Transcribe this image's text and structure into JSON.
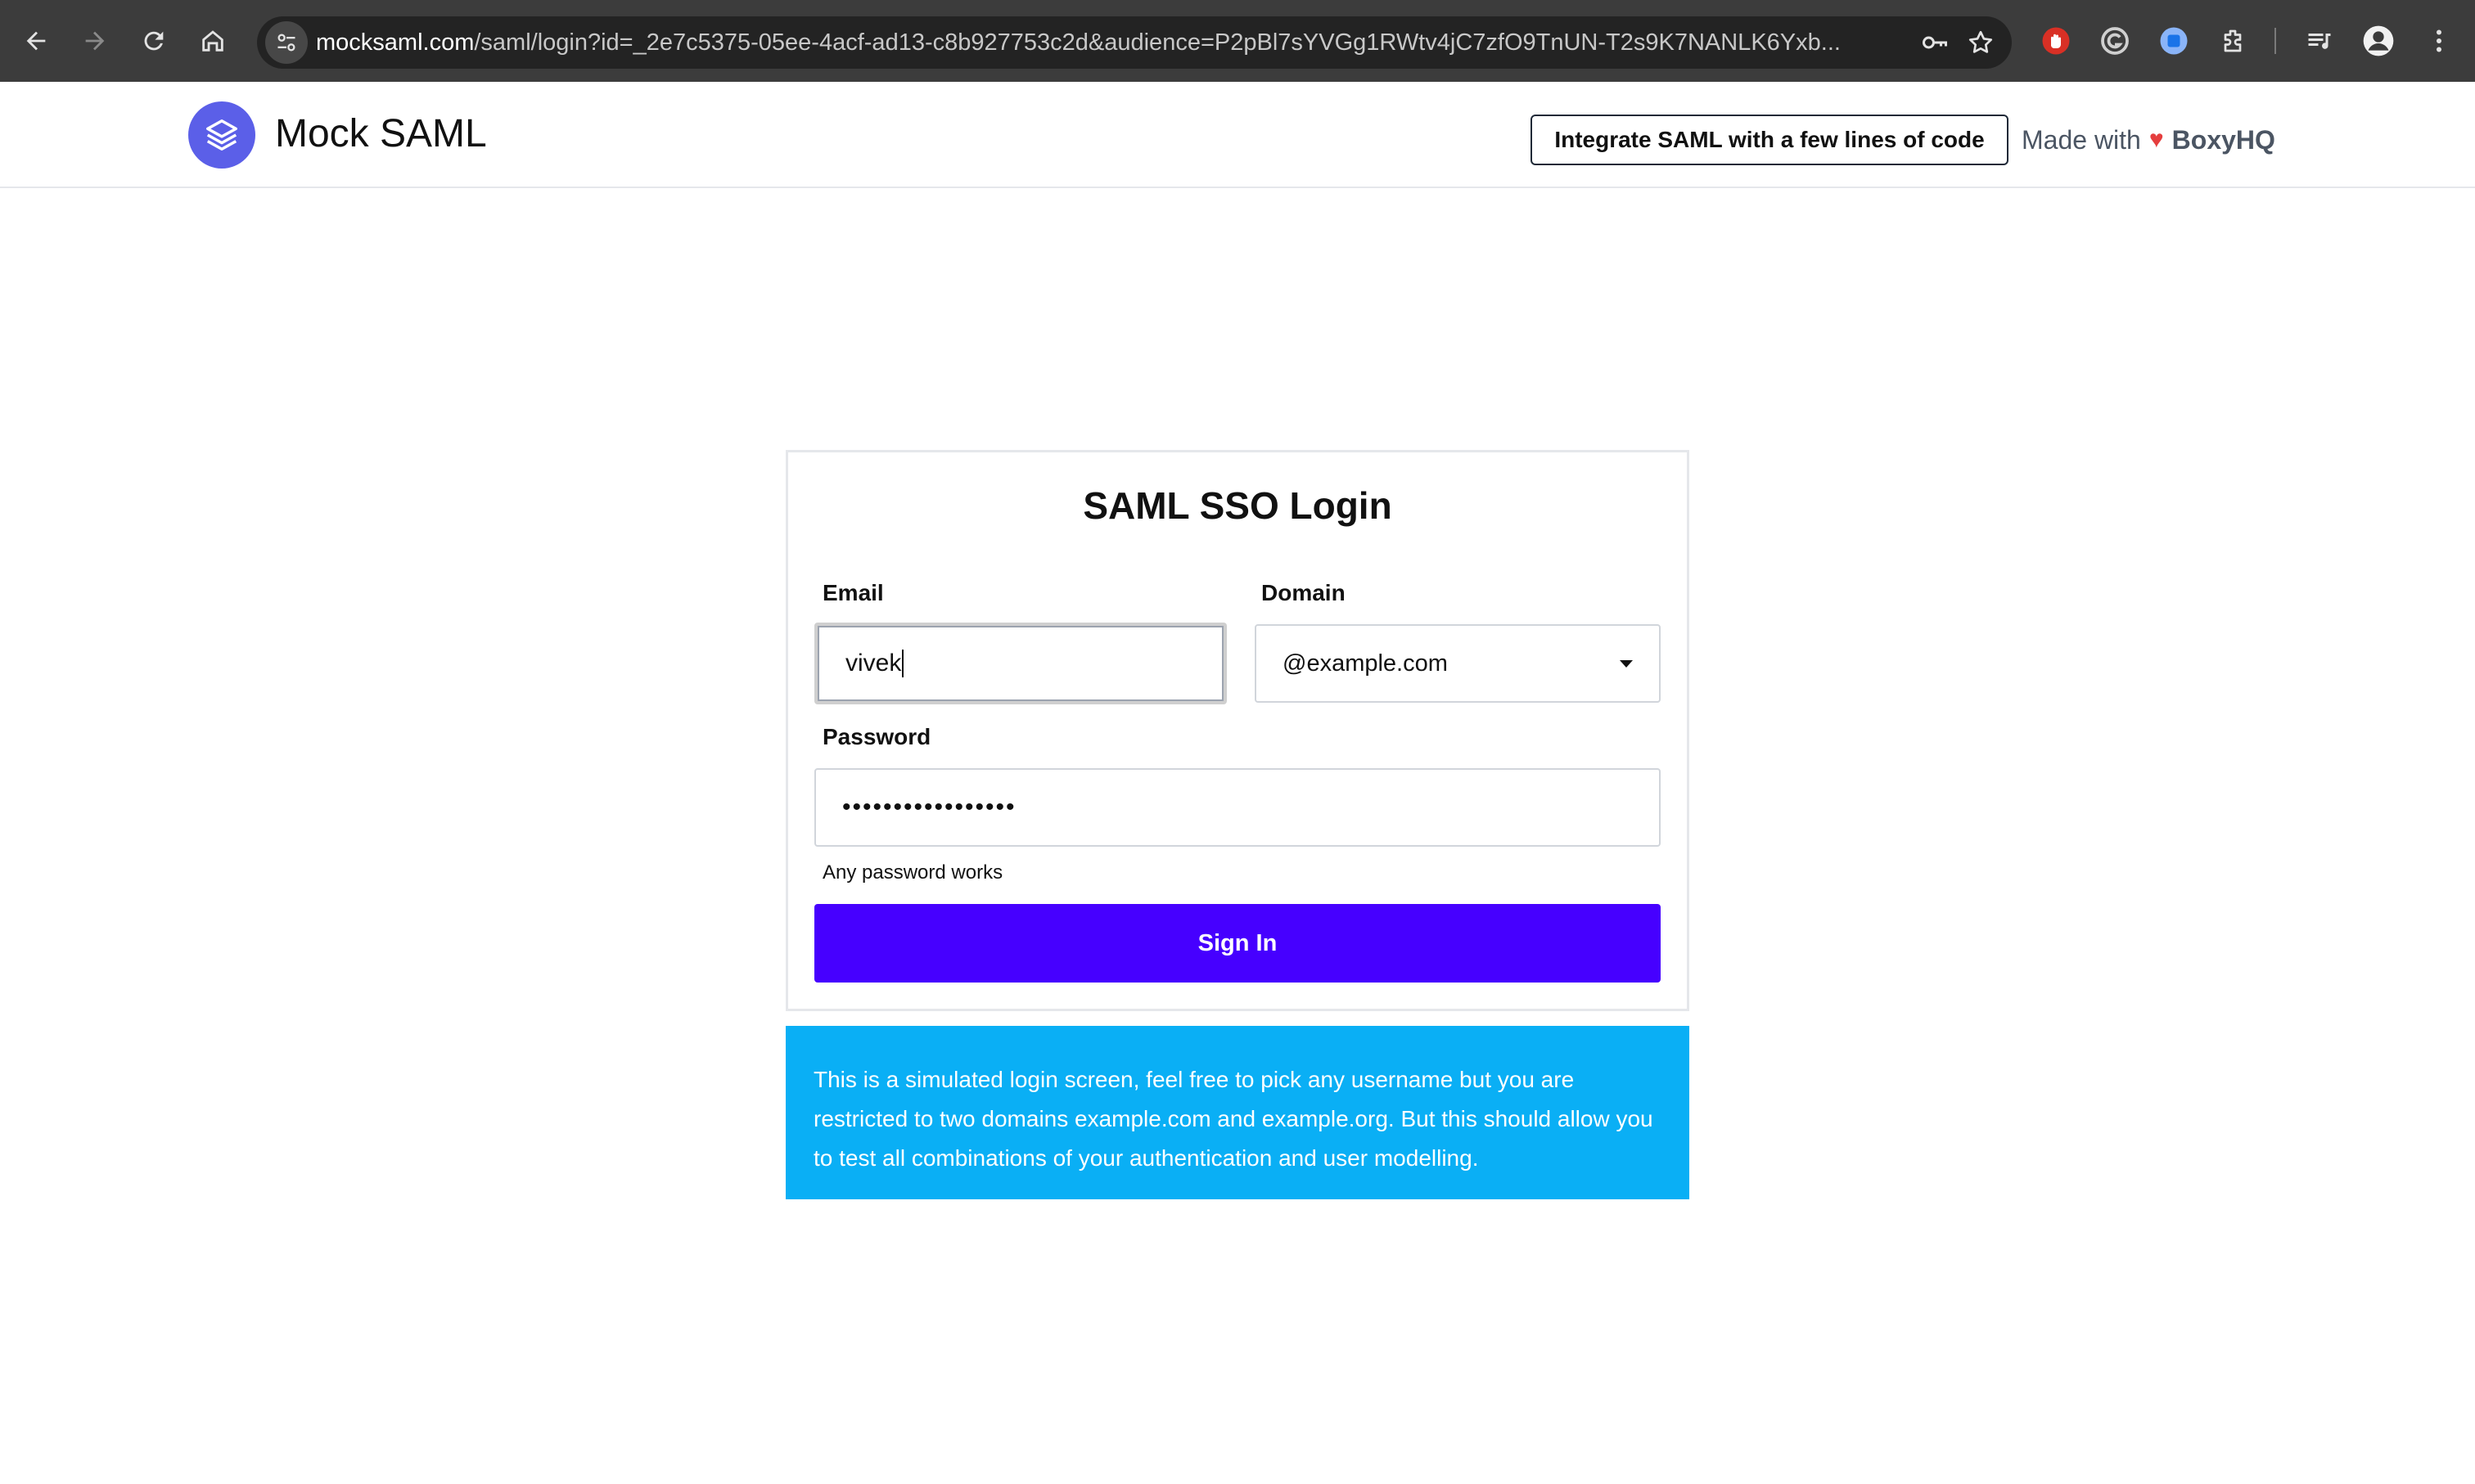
{
  "browser": {
    "url_host": "mocksaml.com",
    "url_path": "/saml/login?id=_2e7c5375-05ee-4acf-ad13-c8b927753c2d&audience=P2pBl7sYVGg1RWtv4jC7zfO9TnUN-T2s9K7NANLK6Yxb..."
  },
  "header": {
    "brand": "Mock SAML",
    "cta_label": "Integrate SAML with a few lines of code",
    "made_with": "Made with",
    "heart": "♥",
    "company": "BoxyHQ"
  },
  "login": {
    "title": "SAML SSO Login",
    "email_label": "Email",
    "email_value": "vivek",
    "domain_label": "Domain",
    "domain_value": "@example.com",
    "password_label": "Password",
    "password_value": "•••••••••••••••••",
    "password_hint": "Any password works",
    "signin_label": "Sign In"
  },
  "info": {
    "text": "This is a simulated login screen, feel free to pick any username but you are restricted to two domains example.com and example.org. But this should allow you to test all combinations of your authentication and user modelling."
  },
  "colors": {
    "brand_purple": "#5b5fe8",
    "signin_bg": "#4600ff",
    "info_bg": "#0aaff5",
    "heart": "#e53e3e"
  }
}
